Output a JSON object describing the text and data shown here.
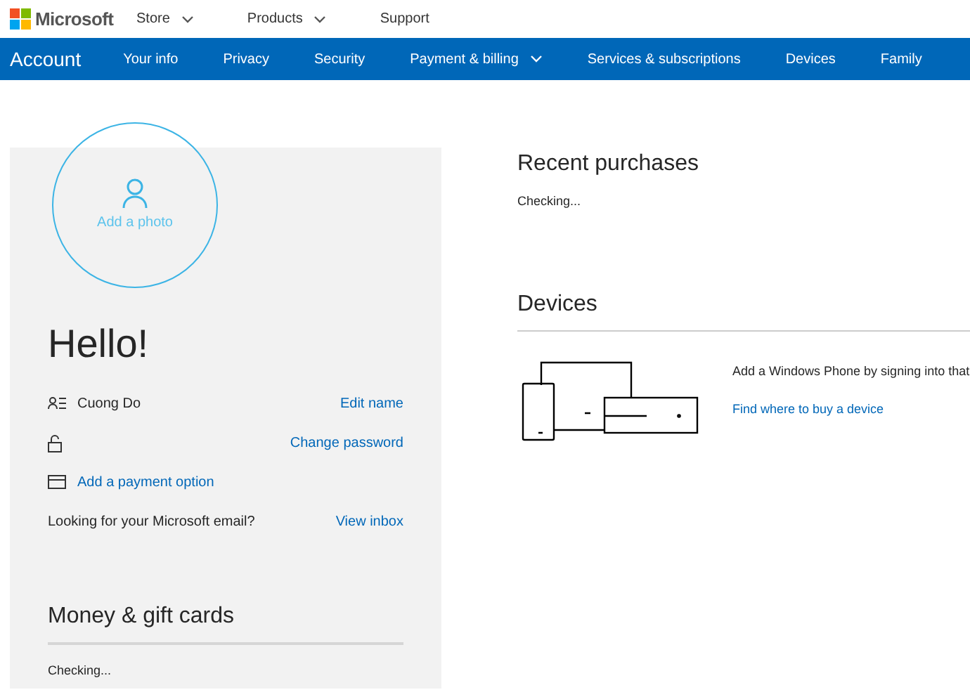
{
  "brand": {
    "name": "Microsoft"
  },
  "top_nav": [
    {
      "label": "Store",
      "dropdown": true
    },
    {
      "label": "Products",
      "dropdown": true
    },
    {
      "label": "Support",
      "dropdown": false
    }
  ],
  "account_nav": {
    "title": "Account",
    "items": [
      {
        "label": "Your info",
        "dropdown": false
      },
      {
        "label": "Privacy",
        "dropdown": false
      },
      {
        "label": "Security",
        "dropdown": false
      },
      {
        "label": "Payment & billing",
        "dropdown": true
      },
      {
        "label": "Services & subscriptions",
        "dropdown": false
      },
      {
        "label": "Devices",
        "dropdown": false
      },
      {
        "label": "Family",
        "dropdown": false
      }
    ]
  },
  "profile": {
    "photo_label": "Add a photo",
    "greeting": "Hello!",
    "rows": [
      {
        "kind": "name",
        "text": "Cuong Do",
        "action": "Edit name"
      },
      {
        "kind": "password",
        "action": "Change password"
      },
      {
        "kind": "payment",
        "link": "Add a payment option"
      },
      {
        "kind": "email",
        "text": "Looking for your Microsoft email?",
        "action": "View inbox"
      }
    ],
    "money": {
      "title": "Money & gift cards",
      "status": "Checking..."
    }
  },
  "recent_purchases": {
    "title": "Recent purchases",
    "status": "Checking..."
  },
  "devices": {
    "title": "Devices",
    "text": "Add a Windows Phone by signing into that",
    "link": "Find where to buy a device"
  }
}
